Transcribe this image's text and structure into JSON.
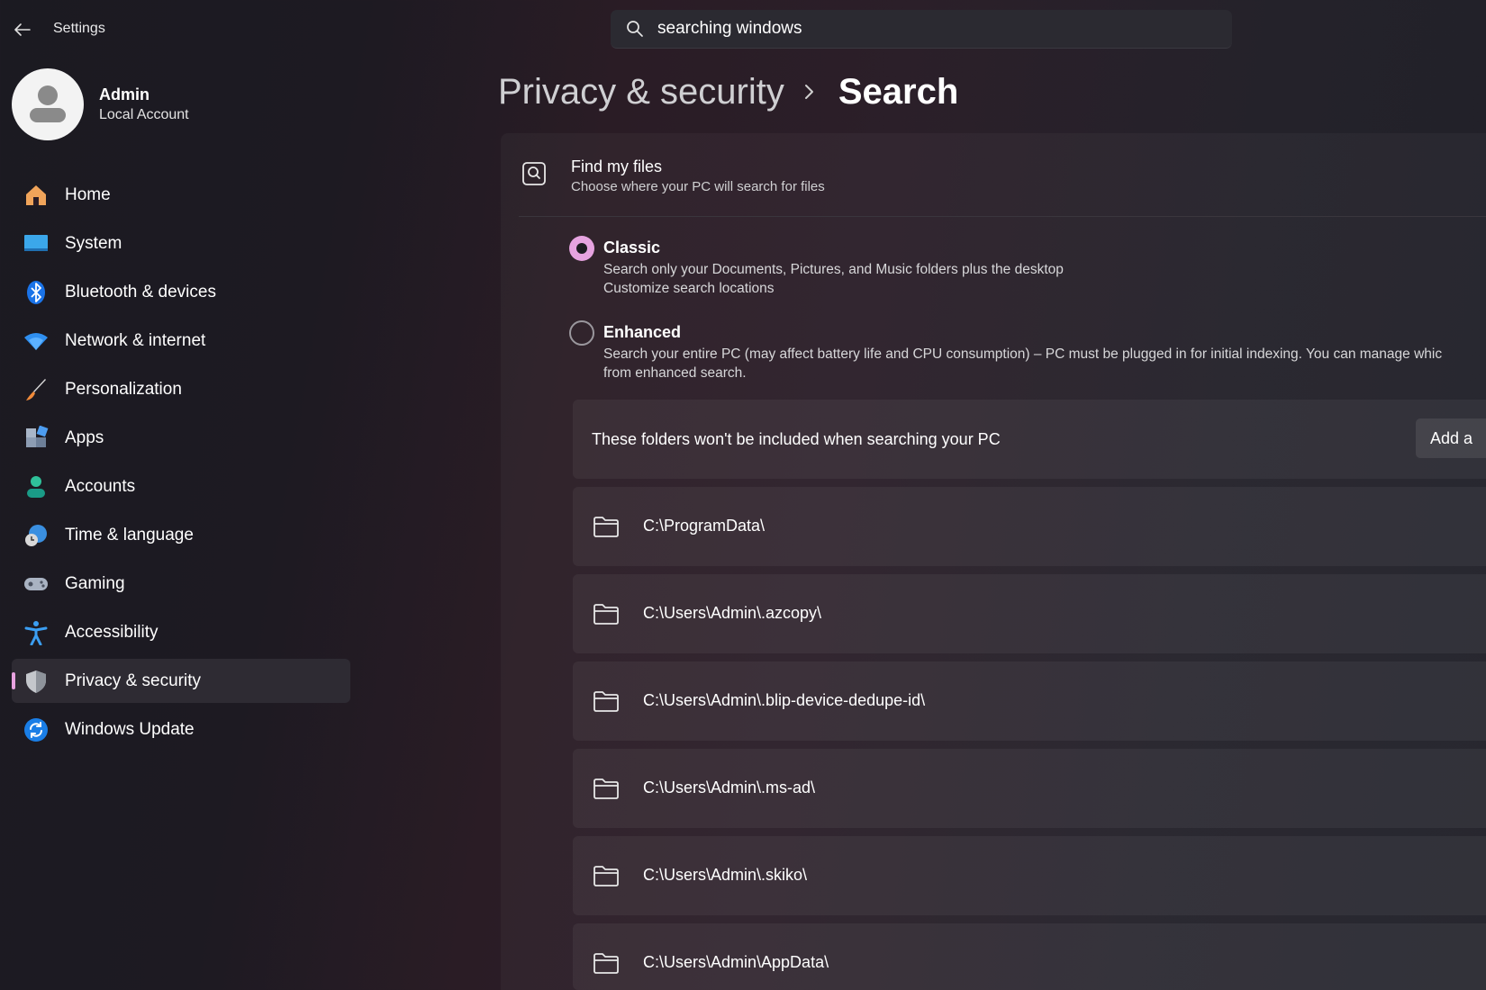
{
  "window": {
    "title": "Settings",
    "search_value": "searching windows"
  },
  "account": {
    "name": "Admin",
    "type": "Local Account"
  },
  "nav": {
    "items": [
      {
        "label": "Home",
        "icon": "home-icon"
      },
      {
        "label": "System",
        "icon": "system-icon"
      },
      {
        "label": "Bluetooth & devices",
        "icon": "bluetooth-icon"
      },
      {
        "label": "Network & internet",
        "icon": "wifi-icon"
      },
      {
        "label": "Personalization",
        "icon": "brush-icon"
      },
      {
        "label": "Apps",
        "icon": "apps-icon"
      },
      {
        "label": "Accounts",
        "icon": "accounts-icon"
      },
      {
        "label": "Time & language",
        "icon": "time-language-icon"
      },
      {
        "label": "Gaming",
        "icon": "gamepad-icon"
      },
      {
        "label": "Accessibility",
        "icon": "accessibility-icon"
      },
      {
        "label": "Privacy & security",
        "icon": "shield-icon",
        "selected": true
      },
      {
        "label": "Windows Update",
        "icon": "update-icon"
      }
    ]
  },
  "breadcrumb": {
    "parent": "Privacy & security",
    "current": "Search"
  },
  "find_my_files": {
    "title": "Find my files",
    "subtitle": "Choose where your PC will search for files",
    "classic": {
      "label": "Classic",
      "description": "Search only your Documents, Pictures, and Music folders plus the desktop",
      "link": "Customize search locations",
      "selected": true
    },
    "enhanced": {
      "label": "Enhanced",
      "description_line1": "Search your entire PC (may affect battery life and CPU consumption) – PC must be plugged in for initial indexing. You can manage whic",
      "description_line2": "from enhanced search.",
      "selected": false
    }
  },
  "excluded": {
    "header": "These folders won't be included when searching your PC",
    "add_label": "Add a",
    "folders": [
      "C:\\ProgramData\\",
      "C:\\Users\\Admin\\.azcopy\\",
      "C:\\Users\\Admin\\.blip-device-dedupe-id\\",
      "C:\\Users\\Admin\\.ms-ad\\",
      "C:\\Users\\Admin\\.skiko\\",
      "C:\\Users\\Admin\\AppData\\"
    ]
  },
  "colors": {
    "accent": "#e6a3e0",
    "background": "#1d1b22"
  }
}
